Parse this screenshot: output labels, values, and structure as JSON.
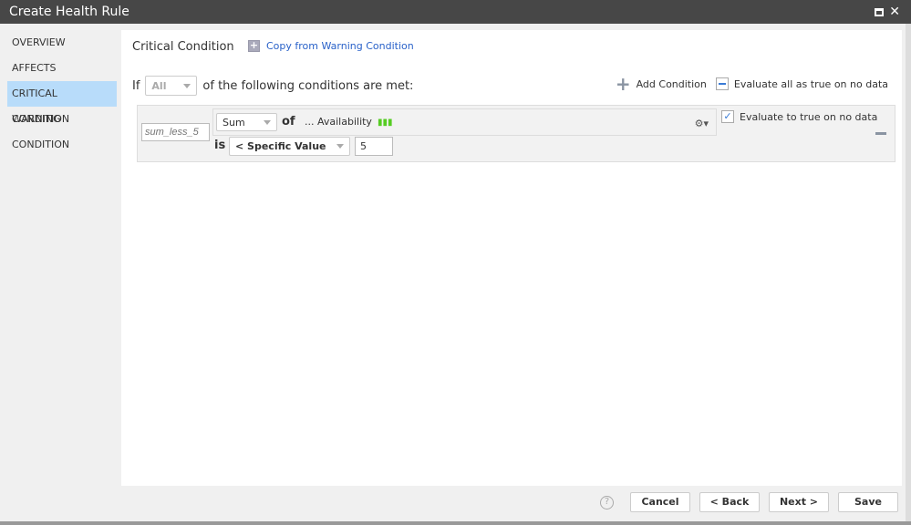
{
  "window": {
    "title": "Create Health Rule",
    "maximize_icon": "maximize-icon",
    "close_icon": "close-icon",
    "close_glyph": "✕"
  },
  "sidebar": {
    "items": [
      {
        "label": "OVERVIEW"
      },
      {
        "label": "AFFECTS"
      },
      {
        "label": "CRITICAL CONDITION",
        "active": true
      },
      {
        "label": "WARNING CONDITION"
      }
    ]
  },
  "main": {
    "heading": "Critical Condition",
    "copy_link": "Copy from Warning Condition",
    "if_label": "If",
    "match_select": "All",
    "match_suffix": "of the following conditions are met:",
    "add_condition": "Add Condition",
    "evaluate_all": "Evaluate all as true on no data",
    "condition": {
      "name_placeholder": "sum_less_5",
      "aggregation": "Sum",
      "of_label": "of",
      "metric": "... Availability",
      "is_label": "is",
      "comparison": "< Specific Value",
      "value": "5",
      "evaluate_true_label": "Evaluate to true on no data",
      "evaluate_true_checked": true
    }
  },
  "footer": {
    "help": "?",
    "cancel": "Cancel",
    "back": "< Back",
    "next": "Next >",
    "save": "Save"
  },
  "colors": {
    "titlebar": "#474747",
    "accent": "#2a62c9",
    "active_nav": "#b8dcfa"
  }
}
